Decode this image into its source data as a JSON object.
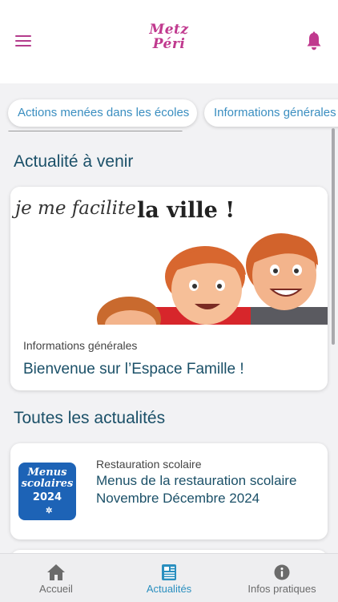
{
  "header": {
    "logo_line1": "Metz",
    "logo_line2": "Péri"
  },
  "icons": {
    "menu": "hamburger-menu-icon",
    "notifications": "bell-icon"
  },
  "chips": [
    {
      "label": "Actions menées dans les écoles"
    },
    {
      "label": "Informations générales"
    }
  ],
  "upcoming": {
    "section_title": "Actualité à venir",
    "image_text_1": "je me facilite",
    "image_text_2": "la ville !",
    "category": "Informations générales",
    "title": "Bienvenue sur l’Espace Famille !"
  },
  "all_news": {
    "section_title": "Toutes les actualités",
    "items": [
      {
        "thumb_line1": "Menus",
        "thumb_line2": "scolaires",
        "thumb_line3": "2024",
        "category": "Restauration scolaire",
        "title": "Menus de la restauration scolaire Novembre Décembre 2024"
      }
    ]
  },
  "tabbar": {
    "items": [
      {
        "label": "Accueil",
        "icon": "home-icon",
        "active": false
      },
      {
        "label": "Actualités",
        "icon": "newspaper-icon",
        "active": true
      },
      {
        "label": "Infos pratiques",
        "icon": "info-icon",
        "active": false
      }
    ]
  },
  "colors": {
    "brand": "#c0398e",
    "title": "#1b5068",
    "accent": "#2a8fbf",
    "chip_text": "#3a8ec0"
  }
}
